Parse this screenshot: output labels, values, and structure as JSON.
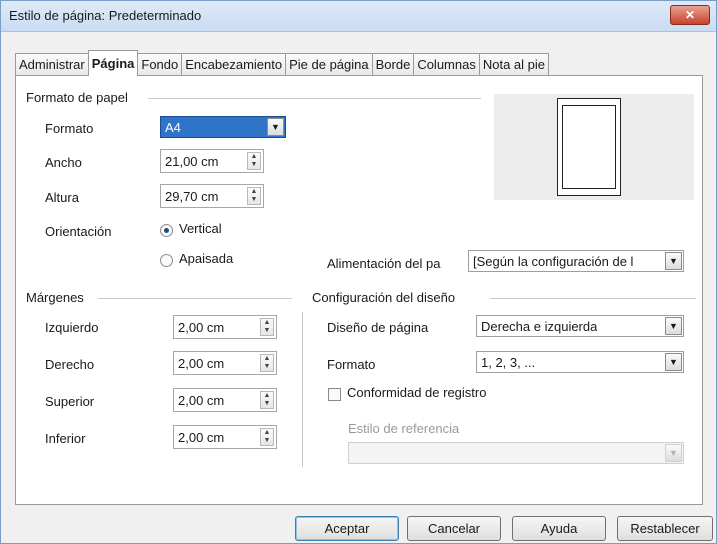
{
  "window": {
    "title": "Estilo de página: Predeterminado",
    "close_glyph": "✕"
  },
  "tabs": [
    {
      "label": "Administrar"
    },
    {
      "label": "Página"
    },
    {
      "label": "Fondo"
    },
    {
      "label": "Encabezamiento"
    },
    {
      "label": "Pie de página"
    },
    {
      "label": "Borde"
    },
    {
      "label": "Columnas"
    },
    {
      "label": "Nota al pie"
    }
  ],
  "paper": {
    "section": "Formato de papel",
    "format_label": "Formato",
    "format_value": "A4",
    "width_label": "Ancho",
    "width_value": "21,00 cm",
    "height_label": "Altura",
    "height_value": "29,70 cm",
    "orientation_label": "Orientación",
    "vertical": "Vertical",
    "landscape": "Apaisada",
    "feed_label": "Alimentación del pa",
    "feed_value": "[Según la configuración de l"
  },
  "margins": {
    "section": "Márgenes",
    "left_label": "Izquierdo",
    "left_value": "2,00 cm",
    "right_label": "Derecho",
    "right_value": "2,00 cm",
    "top_label": "Superior",
    "top_value": "2,00 cm",
    "bottom_label": "Inferior",
    "bottom_value": "2,00 cm"
  },
  "layout": {
    "section": "Configuración del diseño",
    "page_layout_label": "Diseño de página",
    "page_layout_value": "Derecha e izquierda",
    "format_label": "Formato",
    "format_value": "1, 2, 3, ...",
    "register_label": "Conformidad de registro",
    "reference_label": "Estilo de referencia",
    "reference_value": ""
  },
  "buttons": {
    "ok": "Aceptar",
    "cancel": "Cancelar",
    "help": "Ayuda",
    "reset": "Restablecer"
  }
}
